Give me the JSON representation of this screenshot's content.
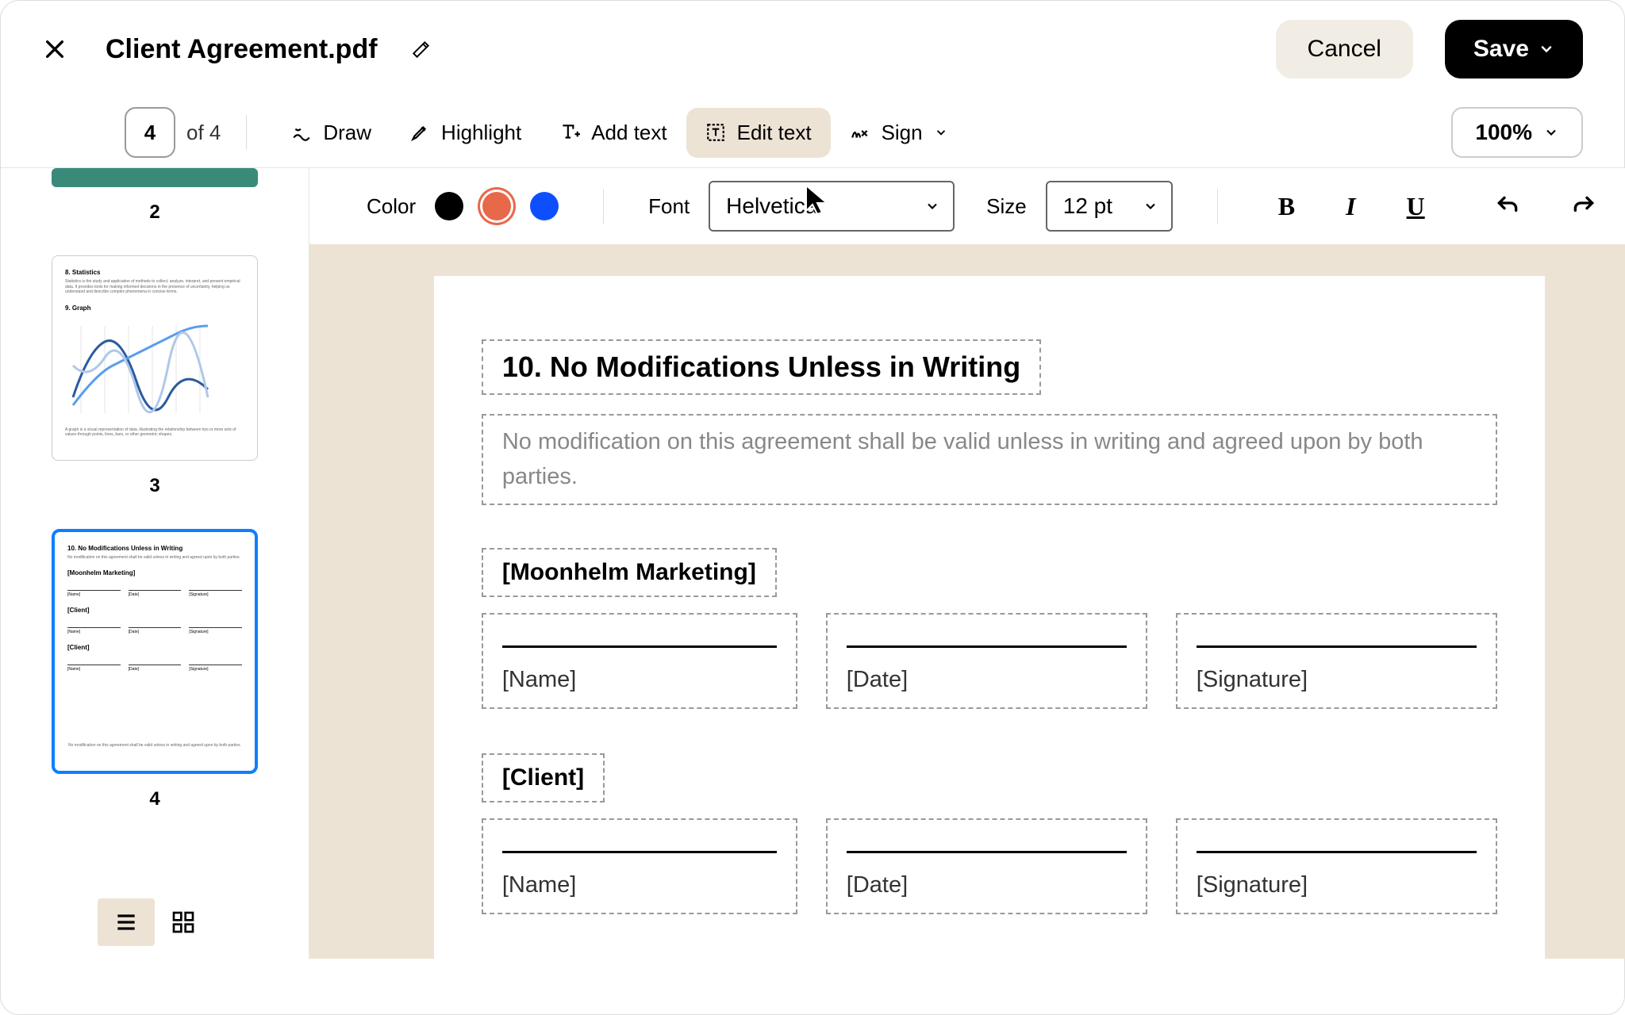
{
  "header": {
    "title": "Client Agreement.pdf",
    "cancel_label": "Cancel",
    "save_label": "Save"
  },
  "toolbar": {
    "page_current": "4",
    "page_of": "of 4",
    "draw_label": "Draw",
    "highlight_label": "Highlight",
    "add_text_label": "Add text",
    "edit_text_label": "Edit text",
    "sign_label": "Sign",
    "zoom_label": "100%"
  },
  "sidebar": {
    "thumbnails": [
      {
        "page": "2"
      },
      {
        "page": "3",
        "heading1": "8. Statistics",
        "body1": "Statistics is the study and application of methods to collect, analyze, interpret, and present empirical data. It provides tools for making informed decisions in the presence of uncertainty, helping us understand and describe complex phenomena in concise terms.",
        "heading2": "9. Graph",
        "body2": "A graph is a visual representation of data, illustrating the relationship between two or more sets of values through points, lines, bars, or other geometric shapes."
      },
      {
        "page": "4",
        "heading1": "10. No Modifications Unless in Writing",
        "body1": "No modification on this agreement shall be valid unless in writing and agreed upon by both parties.",
        "party1": "[Moonhelm Marketing]",
        "party2": "[Client]",
        "footer": "No modification on this agreement shall be valid unless in writing and agreed upon by both parties."
      }
    ]
  },
  "format": {
    "color_label": "Color",
    "font_label": "Font",
    "font_value": "Helvetica",
    "size_label": "Size",
    "size_value": "12 pt",
    "colors": {
      "black": "#000000",
      "orange": "#e8684a",
      "blue": "#0d4fff"
    }
  },
  "document": {
    "section_title": "10. No Modifications Unless in Writing",
    "section_body": "No modification on this agreement shall be valid unless in writing and agreed upon by both parties.",
    "party1": "[Moonhelm Marketing]",
    "party2": "[Client]",
    "sig_name": "[Name]",
    "sig_date": "[Date]",
    "sig_signature": "[Signature]"
  }
}
